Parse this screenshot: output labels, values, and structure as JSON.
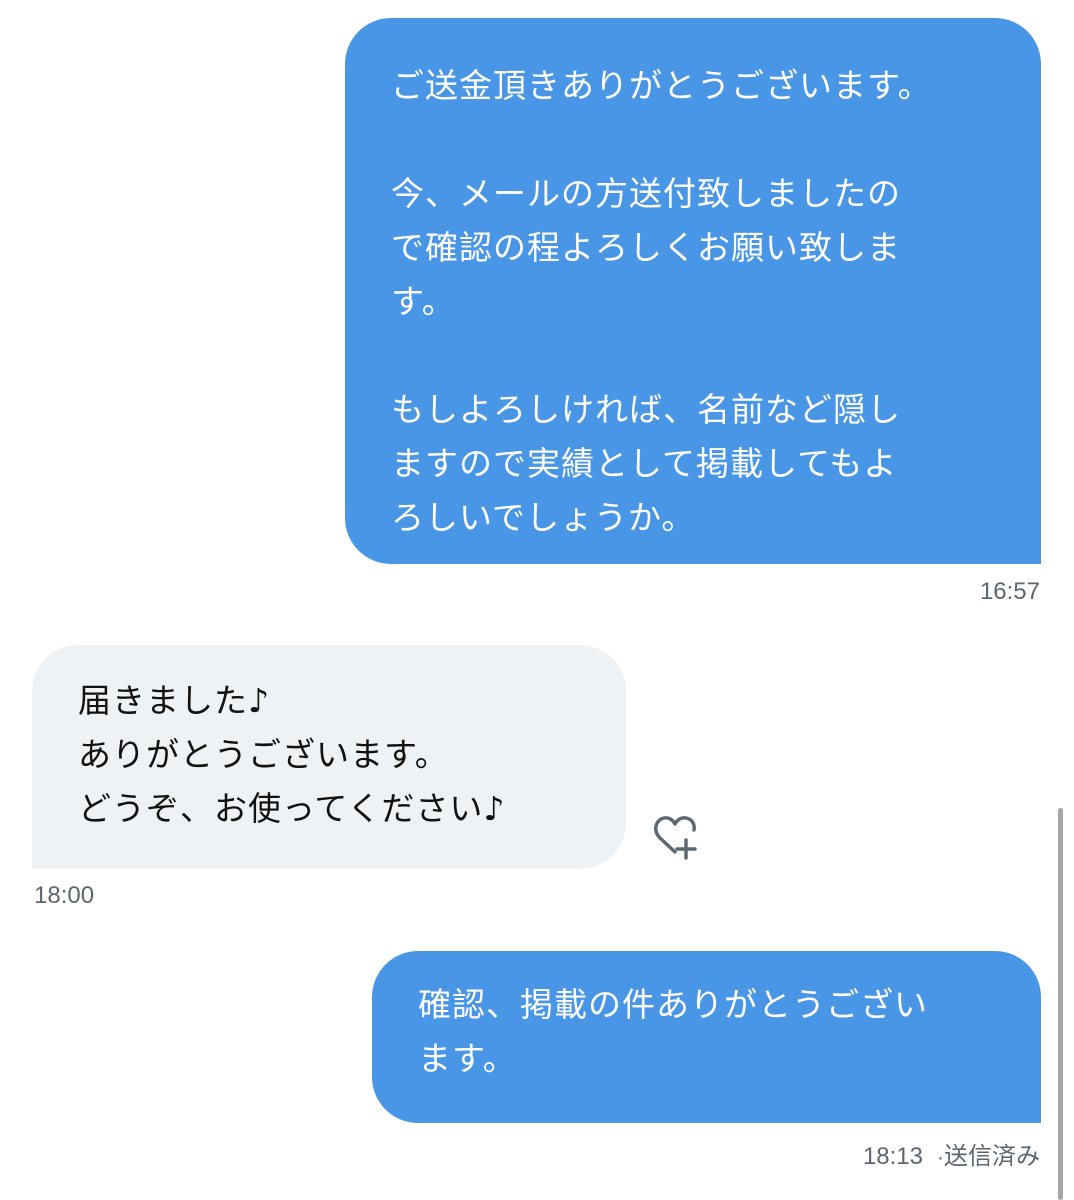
{
  "messages": [
    {
      "direction": "sent",
      "paragraphs": [
        "ご送金頂きありがとうございます。",
        "今、メールの方送付致しましたの\nで確認の程よろしくお願い致しま\nす。",
        "もしよろしければ、名前など隠し\nますので実績として掲載してもよ\nろしいでしょうか。"
      ],
      "time": "16:57"
    },
    {
      "direction": "received",
      "paragraphs": [
        "届きました♪\nありがとうございます。\nどうぞ、お使ってください♪"
      ],
      "time": "18:00"
    },
    {
      "direction": "sent",
      "paragraphs": [
        "確認、掲載の件ありがとうござい\nます。"
      ],
      "time": "18:13",
      "status": "送信済み",
      "status_separator": "·"
    }
  ],
  "icons": {
    "reaction": "heart-plus-icon"
  },
  "colors": {
    "sent_bubble": "#4a96e6",
    "received_bubble": "#eff2f4",
    "timestamp": "#5b6670",
    "icon": "#5b6670"
  }
}
